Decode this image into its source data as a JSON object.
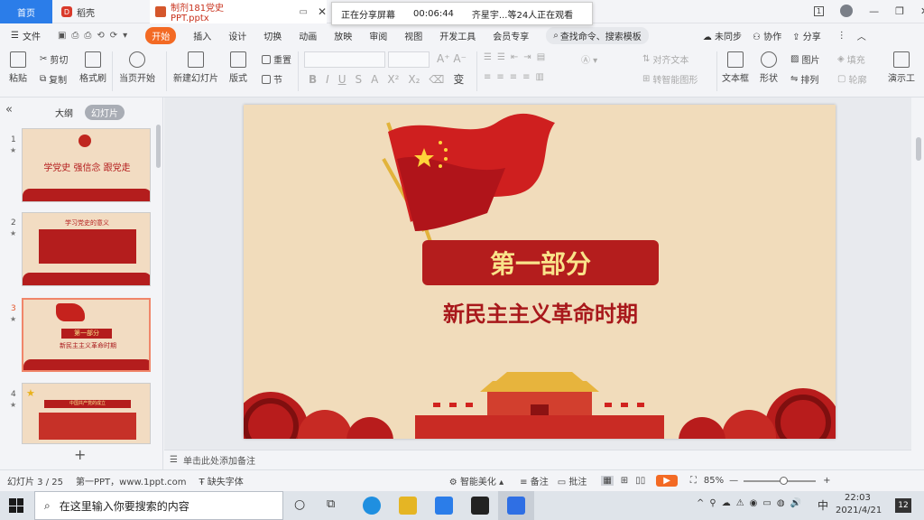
{
  "tabs": {
    "home": "首页",
    "daoke": "稻壳",
    "doc": "制剂181党史PPT.pptx"
  },
  "share_bar": {
    "status": "正在分享屏幕",
    "time": "00:06:44",
    "viewers": "齐星宇...等24人正在观看"
  },
  "window": {
    "badge": "1"
  },
  "menu": {
    "file": "文件",
    "items": [
      "开始",
      "插入",
      "设计",
      "切换",
      "动画",
      "放映",
      "审阅",
      "视图",
      "开发工具",
      "会员专享"
    ],
    "search": "查找命令、搜索模板",
    "unsynced": "未同步",
    "collab": "协作",
    "share": "分享"
  },
  "ribbon": {
    "paste": "粘贴",
    "cut": "剪切",
    "copy": "复制",
    "format_painter": "格式刷",
    "from_current": "当页开始",
    "new_slide": "新建幻灯片",
    "layout": "版式",
    "section": "节",
    "reset": "重置",
    "align_text": "对齐文本",
    "smart_graphic": "转智能图形",
    "textbox": "文本框",
    "shape": "形状",
    "picture": "图片",
    "arrange": "排列",
    "fill": "填充",
    "outline": "轮廓",
    "present": "演示工"
  },
  "panel": {
    "outline_tab": "大纲",
    "slides_tab": "幻灯片"
  },
  "thumbs": [
    {
      "num": "1",
      "star": "★",
      "text": "学党史 强信念 跟党走"
    },
    {
      "num": "2",
      "star": "★",
      "text": "学习党史的意义"
    },
    {
      "num": "3",
      "star": "★",
      "text": "第一部分",
      "sub": "新民主主义革命时期"
    },
    {
      "num": "4",
      "star": "★",
      "text": "中国共产党的成立"
    }
  ],
  "add_slide": "+",
  "slide": {
    "title": "第一部分",
    "subtitle": "新民主主义革命时期"
  },
  "notes": "单击此处添加备注",
  "status": {
    "slide_count": "幻灯片 3 / 25",
    "theme": "第一PPT，www.1ppt.com",
    "missing_font": "缺失字体",
    "beautify": "智能美化",
    "notes_btn": "备注",
    "comment": "批注",
    "zoom": "85%"
  },
  "taskbar": {
    "search_placeholder": "在这里输入你要搜索的内容",
    "ime": "中",
    "time": "22:03",
    "date": "2021/4/21",
    "notif": "12"
  },
  "colors": {
    "accent": "#f36a24",
    "home_tab": "#2b7de9",
    "title_box": "#b41d1d",
    "title_text": "#f9e38a",
    "subtitle": "#a8181b",
    "slide_bg": "#f1dcbb"
  }
}
